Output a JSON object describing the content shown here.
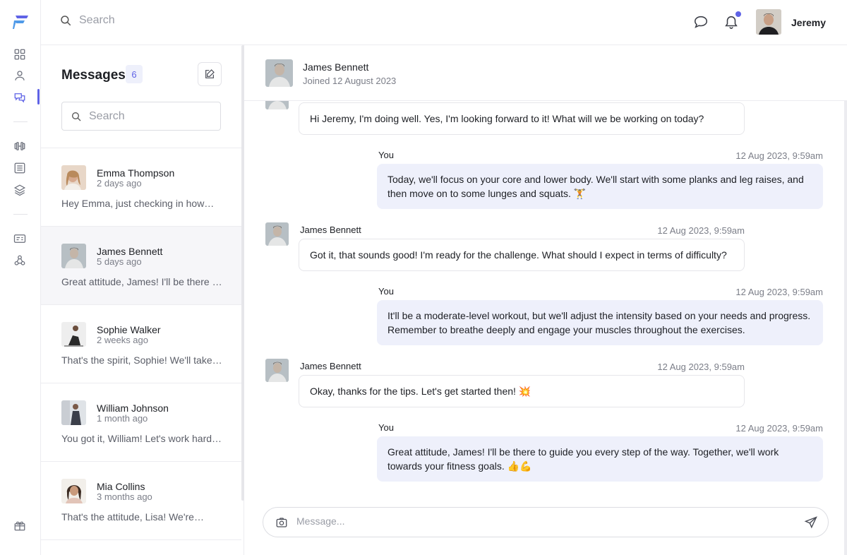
{
  "topbar": {
    "search_placeholder": "Search",
    "username": "Jeremy"
  },
  "sidebar": {
    "items": [
      {
        "name": "dashboard-icon"
      },
      {
        "name": "user-icon"
      },
      {
        "name": "messages-icon",
        "active": true
      },
      {
        "name": "dumbbell-icon"
      },
      {
        "name": "list-icon"
      },
      {
        "name": "layers-icon"
      },
      {
        "name": "id-card-icon"
      },
      {
        "name": "webhook-icon"
      },
      {
        "name": "gift-icon"
      }
    ],
    "accent": "#5f63e6"
  },
  "conversations": {
    "title": "Messages",
    "count": "6",
    "search_placeholder": "Search",
    "items": [
      {
        "name": "Emma Thompson",
        "time": "2 days ago",
        "preview": "Hey Emma, just checking in how…"
      },
      {
        "name": "James Bennett",
        "time": "5 days ago",
        "preview": "Great attitude, James! I'll be there t…",
        "active": true
      },
      {
        "name": "Sophie Walker",
        "time": "2 weeks ago",
        "preview": "That's the spirit, Sophie! We'll take …"
      },
      {
        "name": "William Johnson",
        "time": "1 month ago",
        "preview": "You got it, William! Let's work hard…"
      },
      {
        "name": "Mia Collins",
        "time": "3 months ago",
        "preview": "That's the attitude, Lisa! We're…"
      }
    ]
  },
  "chat": {
    "contact_name": "James Bennett",
    "contact_sub": "Joined 12 August 2023",
    "messages": [
      {
        "from": "them",
        "sender": "",
        "time": "",
        "text": "Hi Jeremy, I'm doing well. Yes, I'm looking forward to it! What will we be working on today?"
      },
      {
        "from": "me",
        "sender": "You",
        "time": "12 Aug 2023, 9:59am",
        "text": "Today, we'll focus on your core and lower body. We'll start with some planks and leg raises, and then move on to some lunges and squats. 🏋"
      },
      {
        "from": "them",
        "sender": "James Bennett",
        "time": "12 Aug 2023, 9:59am",
        "text": "Got it, that sounds good! I'm ready for the challenge. What should I expect in terms of difficulty?"
      },
      {
        "from": "me",
        "sender": "You",
        "time": "12 Aug 2023, 9:59am",
        "text": "It'll be a moderate-level workout, but we'll adjust the intensity based on your needs and progress. Remember to breathe deeply and engage your muscles throughout the exercises."
      },
      {
        "from": "them",
        "sender": "James Bennett",
        "time": "12 Aug 2023, 9:59am",
        "text": "Okay, thanks for the tips. Let's get started then! 💥"
      },
      {
        "from": "me",
        "sender": "You",
        "time": "12 Aug 2023, 9:59am",
        "text": "Great attitude, James! I'll be there to guide you every step of the way. Together, we'll work towards your fitness goals. 👍💪"
      }
    ],
    "composer_placeholder": "Message..."
  }
}
